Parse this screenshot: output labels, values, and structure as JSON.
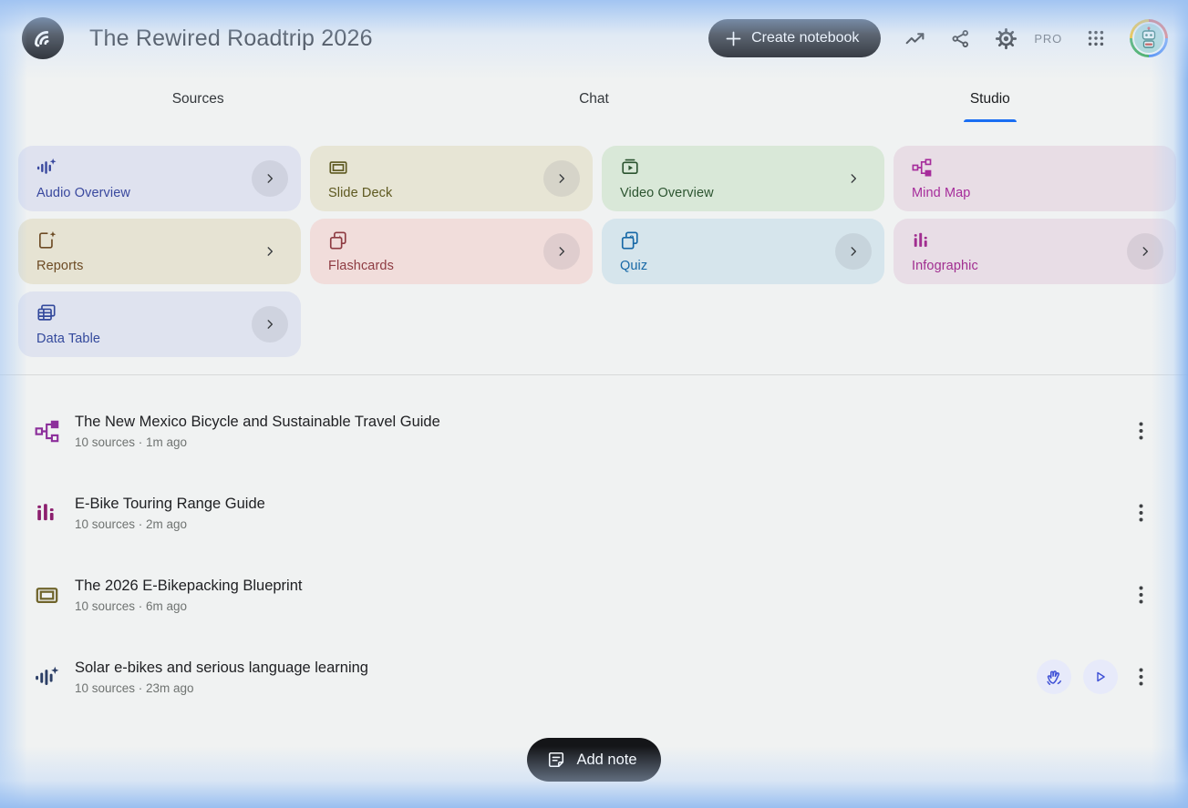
{
  "header": {
    "app_logo": "notebooklm-logo",
    "title": "The Rewired Roadtrip 2026",
    "create_notebook_label": "Create notebook",
    "pro_badge": "PRO",
    "icons": [
      "trending-up-icon",
      "share-icon",
      "settings-gear-icon",
      "apps-grid-icon",
      "account-avatar"
    ]
  },
  "tabs": {
    "items": [
      {
        "label": "Sources"
      },
      {
        "label": "Chat"
      },
      {
        "label": "Studio"
      }
    ],
    "active": "Studio",
    "active_underline_color": "#1a6ef3"
  },
  "studio_tools": [
    {
      "label": "Audio Overview",
      "icon": "audio-waveform-sparkle-icon",
      "bg": "#dfe2ef",
      "fg": "#39489e",
      "chevron": "circle"
    },
    {
      "label": "Slide Deck",
      "icon": "slide-deck-icon",
      "bg": "#e7e5d5",
      "fg": "#5d581f",
      "chevron": "circle"
    },
    {
      "label": "Video Overview",
      "icon": "video-overview-icon",
      "bg": "#d9e8d8",
      "fg": "#2c5430",
      "chevron": "plain"
    },
    {
      "label": "Mind Map",
      "icon": "mind-map-icon",
      "bg": "#e8dde5",
      "fg": "#a62c9b",
      "chevron": "none"
    },
    {
      "label": "Reports",
      "icon": "report-sparkle-icon",
      "bg": "#e6e3d3",
      "fg": "#6d4b24",
      "chevron": "plain"
    },
    {
      "label": "Flashcards",
      "icon": "flashcards-icon",
      "bg": "#f1dddb",
      "fg": "#8e3b42",
      "chevron": "circle"
    },
    {
      "label": "Quiz",
      "icon": "quiz-icon",
      "bg": "#d6e5ec",
      "fg": "#1668a6",
      "chevron": "circle"
    },
    {
      "label": "Infographic",
      "icon": "infographic-bars-icon",
      "bg": "#e8dde6",
      "fg": "#a12e90",
      "chevron": "circle"
    },
    {
      "label": "Data Table",
      "icon": "data-table-icon",
      "bg": "#dfe3ef",
      "fg": "#33499c",
      "chevron": "circle"
    }
  ],
  "artifacts": [
    {
      "icon": "mind-map-icon",
      "title": "The New Mexico Bicycle and Sustainable Travel Guide",
      "meta": "10 sources · 1m ago"
    },
    {
      "icon": "infographic-bars-icon",
      "title": "E-Bike Touring Range Guide",
      "meta": "10 sources · 2m ago"
    },
    {
      "icon": "slide-deck-icon",
      "title": "The 2026 E-Bikepacking Blueprint",
      "meta": "10 sources · 6m ago"
    },
    {
      "icon": "audio-waveform-sparkle-icon",
      "title": "Solar e-bikes and serious language learning",
      "meta": "10 sources · 23m ago",
      "actions": [
        "interactive-mode-button",
        "play-audio-button"
      ]
    }
  ],
  "footer": {
    "add_note_label": "Add note"
  }
}
